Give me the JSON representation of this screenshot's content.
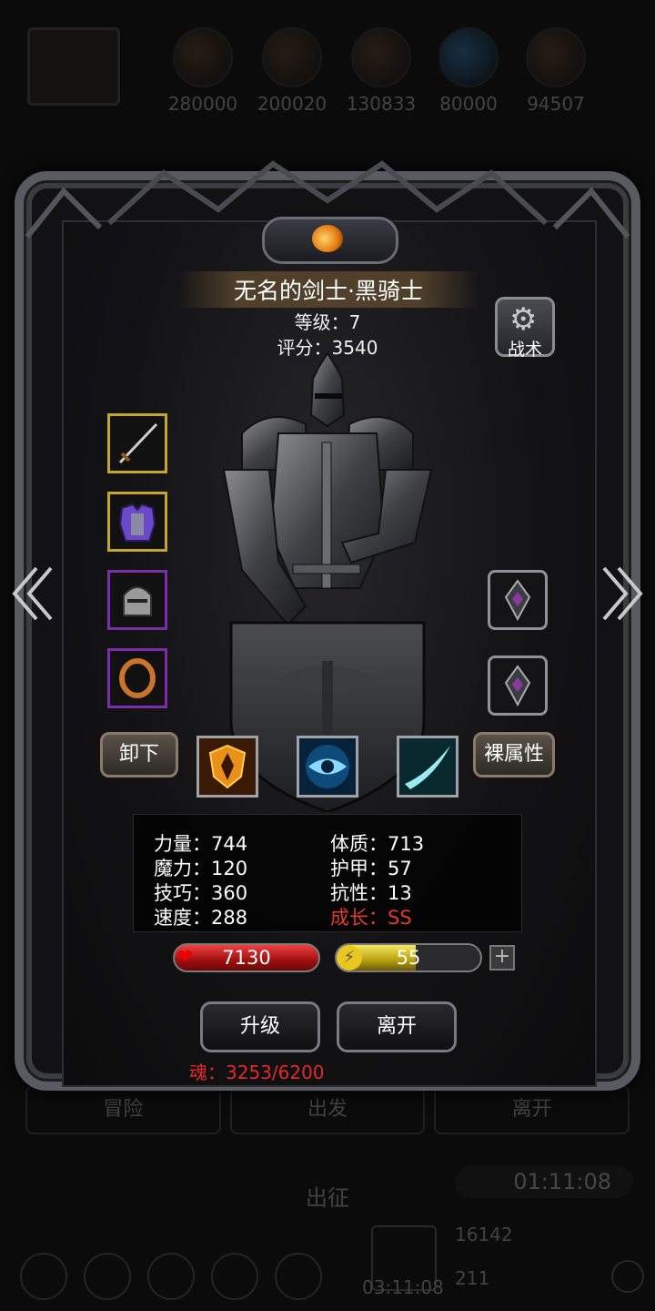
{
  "background": {
    "resources": [
      {
        "icon": "meat-resource-icon",
        "value": "280000"
      },
      {
        "icon": "wood-resource-icon",
        "value": "200020"
      },
      {
        "icon": "stone-resource-icon",
        "value": "130833"
      },
      {
        "icon": "crystal-resource-icon",
        "value": "80000"
      },
      {
        "icon": "iron-resource-icon",
        "value": "94507"
      }
    ],
    "tabs": [
      "冒险",
      "出发",
      "离开"
    ],
    "sortie_label": "出征",
    "timer_top": "01:11:08",
    "res_a": "16142",
    "res_b": "211",
    "timer_bottom": "03:11:08"
  },
  "hero": {
    "name": "无名的剑士·黑骑士",
    "level": "等级：7",
    "score": "评分：3540"
  },
  "tactics_label": "战术",
  "equipment": {
    "weapon": "sword-icon",
    "armor": "armor-icon",
    "helmet": "helmet-icon",
    "ring": "ring-icon",
    "gem1": "gem-icon",
    "gem2": "gem-icon"
  },
  "buttons": {
    "unequip": "卸下",
    "naked_attr": "裸属性",
    "upgrade": "升级",
    "leave": "离开"
  },
  "skills": [
    "shield-fire-skill-icon",
    "eye-skill-icon",
    "slash-skill-icon"
  ],
  "stats": {
    "strength": "力量：744",
    "constitution": "体质：713",
    "magic": "魔力：120",
    "armor": "护甲：57",
    "skill": "技巧：360",
    "resist": "抗性：13",
    "speed": "速度：288",
    "growth": "成长：SS"
  },
  "hp": {
    "value": "7130",
    "fill": 1.0
  },
  "energy": {
    "value": "55",
    "fill": 0.55
  },
  "soul": "魂：3253/6200",
  "colors": {
    "growth": "#e03a2a",
    "soul": "#e02a2a",
    "gold_border": "#c4a628",
    "epic_border": "#7a2ea8"
  }
}
